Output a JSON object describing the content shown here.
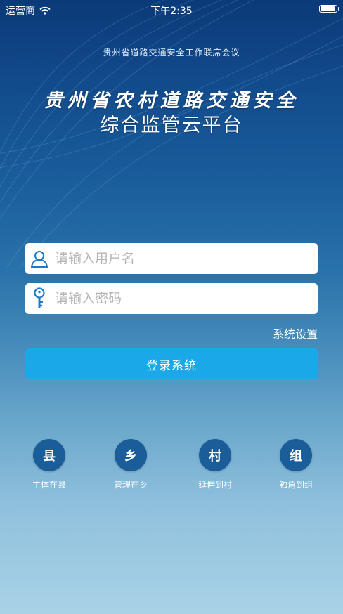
{
  "status_bar": {
    "carrier": "运营商",
    "time": "下午2:35",
    "battery_level": 1.0
  },
  "header": {
    "org": "贵州省道路交通安全工作联席会议",
    "title_line1": "贵州省农村道路交通安全",
    "title_line2": "综合监管云平台"
  },
  "login": {
    "username_placeholder": "请输入用户名",
    "password_placeholder": "请输入密码",
    "settings_label": "系统设置",
    "login_label": "登录系统"
  },
  "features": [
    {
      "char": "县",
      "label": "主体在县"
    },
    {
      "char": "乡",
      "label": "管理在乡"
    },
    {
      "char": "村",
      "label": "延伸到村"
    },
    {
      "char": "组",
      "label": "触角到组"
    }
  ],
  "colors": {
    "accent": "#1aa8e8",
    "circle": "#1b5d99",
    "icon_blue": "#1f78c8"
  },
  "icons": {
    "wifi": "wifi-icon",
    "battery": "battery-icon",
    "user": "user-icon",
    "key": "key-icon"
  }
}
